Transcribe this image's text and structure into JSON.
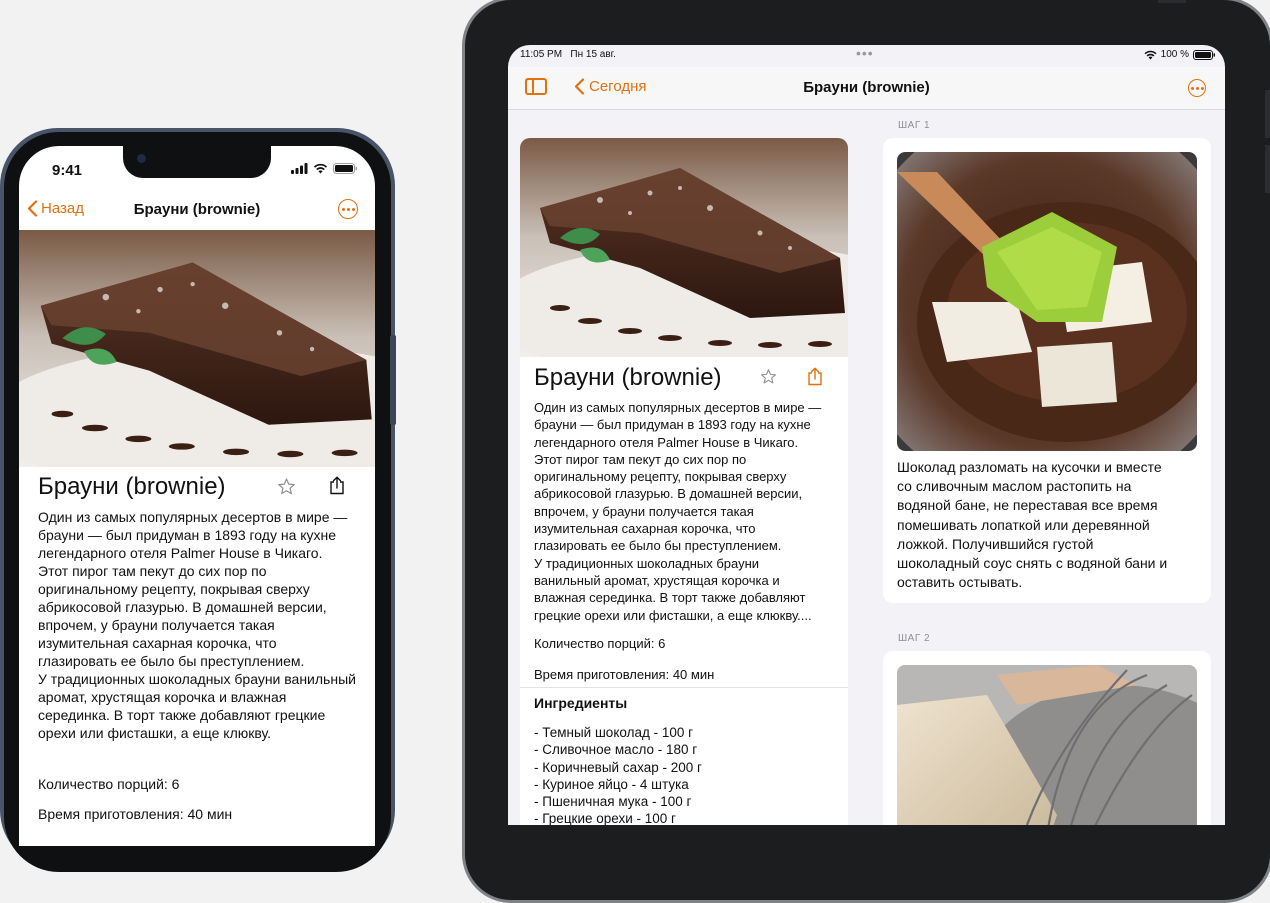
{
  "colors": {
    "accent": "#e2700f",
    "background": "#f2f2f7"
  },
  "tablet": {
    "status": {
      "time": "11:05 PM",
      "date": "Пн 15 авг.",
      "battery": "100 %"
    },
    "nav": {
      "back_label": "Сегодня",
      "title": "Брауни (brownie)"
    },
    "recipe": {
      "title": "Брауни (brownie)",
      "description_lines": [
        "Один из самых популярных десертов в мире —",
        "брауни — был придуман в 1893 году на кухне",
        "легендарного отеля Palmer House в Чикаго.",
        "Этот пирог там пекут до сих пор по",
        "оригинальному рецепту, покрывая сверху",
        "абрикосовой глазурью. В домашней версии,",
        "впрочем, у брауни получается такая",
        "изумительная сахарная корочка, что",
        "глазировать ее было бы преступлением.",
        "У традиционных шоколадных брауни",
        "ванильный аромат, хрустящая корочка и",
        "влажная серединка. В торт также добавляют",
        "грецкие орехи или фисташки, а еще клюкву...."
      ],
      "servings": "Количество порций: 6",
      "cook_time": "Время приготовления: 40 мин",
      "ingredients_heading": "Ингредиенты",
      "ingredients": [
        "- Темный шоколад - 100 г",
        "- Сливочное масло - 180 г",
        "- Коричневый сахар - 200 г",
        "- Куриное яйцо - 4 штука",
        "- Пшеничная мука - 100 г",
        "- Грецкие орехи - 100 г"
      ]
    },
    "steps": [
      {
        "label": "ШАГ 1",
        "text_lines": [
          "Шоколад разломать на кусочки и вместе",
          "со сливочным маслом растопить на",
          "водяной бане, не переставая все время",
          "помешивать лопаткой или деревянной",
          "ложкой. Получившийся густой",
          "шоколадный соус снять с водяной бани и",
          "оставить остывать."
        ]
      },
      {
        "label": "ШАГ 2"
      }
    ]
  },
  "phone": {
    "status": {
      "time": "9:41"
    },
    "nav": {
      "back_label": "Назад",
      "title": "Брауни (brownie)"
    },
    "recipe": {
      "title": "Брауни (brownie)",
      "description_lines": [
        "Один из самых популярных десертов в мире —",
        "брауни — был придуман в 1893 году на кухне",
        "легендарного отеля Palmer House в Чикаго.",
        "Этот пирог там пекут до сих пор по",
        "оригинальному рецепту, покрывая сверху",
        "абрикосовой глазурью. В домашней версии,",
        "впрочем, у брауни получается такая",
        "изумительная сахарная корочка, что",
        "глазировать ее было бы преступлением.",
        "У традиционных шоколадных брауни ванильный",
        "аромат, хрустящая корочка и влажная",
        "серединка. В торт также добавляют грецкие",
        "орехи или фисташки, а еще клюкву."
      ],
      "servings": "Количество порций: 6",
      "cook_time": "Время приготовления: 40 мин"
    }
  }
}
